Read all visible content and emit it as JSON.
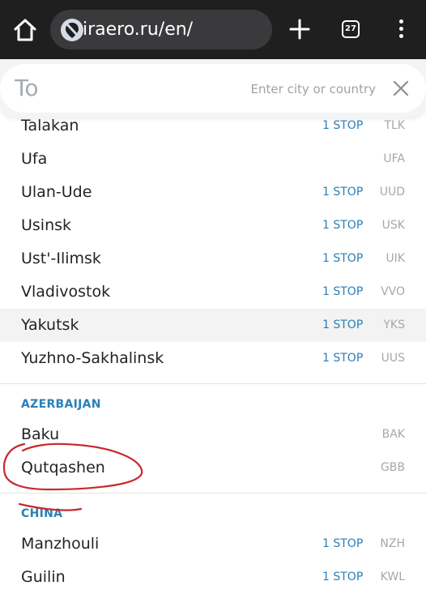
{
  "browser": {
    "url": "iraero.ru/en/",
    "tab_count": "27"
  },
  "search": {
    "label": "To",
    "placeholder": "Enter city or country"
  },
  "accent_color": "#2a7fb8",
  "annotation_color": "#c8282d",
  "sections": [
    {
      "country": "",
      "rows": [
        {
          "city": "Talakan",
          "stops": "1 STOP",
          "code": "TLK"
        },
        {
          "city": "Ufa",
          "stops": "",
          "code": "UFA"
        },
        {
          "city": "Ulan-Ude",
          "stops": "1 STOP",
          "code": "UUD"
        },
        {
          "city": "Usinsk",
          "stops": "1 STOP",
          "code": "USK"
        },
        {
          "city": "Ust'-Ilimsk",
          "stops": "1 STOP",
          "code": "UIK"
        },
        {
          "city": "Vladivostok",
          "stops": "1 STOP",
          "code": "VVO"
        },
        {
          "city": "Yakutsk",
          "stops": "1 STOP",
          "code": "YKS"
        },
        {
          "city": "Yuzhno-Sakhalinsk",
          "stops": "1 STOP",
          "code": "UUS"
        }
      ]
    },
    {
      "country": "AZERBAIJAN",
      "rows": [
        {
          "city": "Baku",
          "stops": "",
          "code": "BAK"
        },
        {
          "city": "Qutqashen",
          "stops": "",
          "code": "GBB"
        }
      ]
    },
    {
      "country": "CHINA",
      "rows": [
        {
          "city": "Manzhouli",
          "stops": "1 STOP",
          "code": "NZH"
        },
        {
          "city": "Guilin",
          "stops": "1 STOP",
          "code": "KWL"
        }
      ]
    }
  ]
}
